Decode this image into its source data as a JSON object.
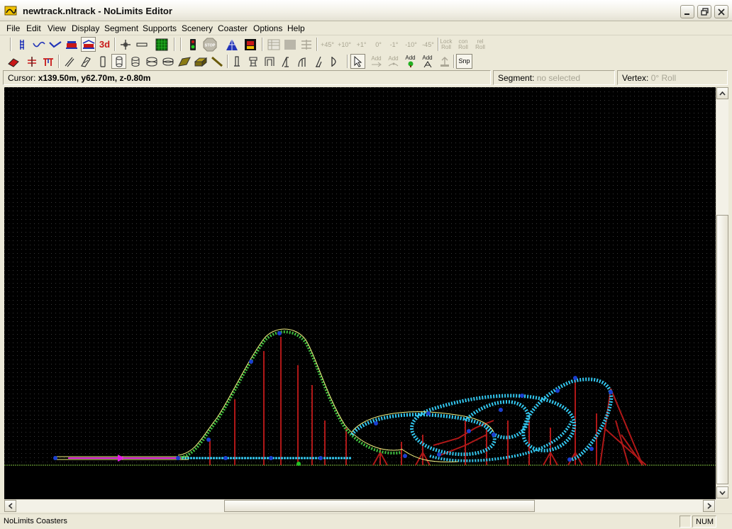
{
  "window": {
    "title": "newtrack.nltrack - NoLimits Editor",
    "controls": [
      "minimize",
      "restore",
      "close"
    ]
  },
  "menu": {
    "items": [
      "File",
      "Edit",
      "View",
      "Display",
      "Segment",
      "Supports",
      "Scenery",
      "Coaster",
      "Options",
      "Help"
    ]
  },
  "toolbar1": {
    "threed_label": "3d",
    "stop_label": "STOP",
    "roll_buttons": [
      "+45°",
      "+10°",
      "+1°",
      "0°",
      "-1°",
      "-10°",
      "-45°"
    ],
    "lock_roll_top": "Lock",
    "lock_roll_bottom": "Roll",
    "con_roll_top": "con",
    "con_roll_bottom": "Roll",
    "rel_roll_top": "rel",
    "rel_roll_bottom": "Roll"
  },
  "toolbar2": {
    "add_label": "Add",
    "snap_label": "Snp"
  },
  "info": {
    "cursor_label": "Cursor:",
    "cursor_value": "x139.50m, y62.70m, z-0.80m",
    "segment_label": "Segment:",
    "segment_value": "no selected",
    "vertex_label": "Vertex:",
    "vertex_value": "0° Roll"
  },
  "status": {
    "text": "NoLimits Coasters",
    "num": "NUM"
  },
  "colors": {
    "canvas": "#000000",
    "grid_dot": "#3a3a3a",
    "ground_line": "#7fbf3f",
    "track_green": "#3fbf3f",
    "track_cyan": "#33c8f0",
    "support_red": "#b01818",
    "rail_yellow": "#f0f080",
    "station_magenta": "#e020e0",
    "node_blue": "#1a3fd0"
  }
}
